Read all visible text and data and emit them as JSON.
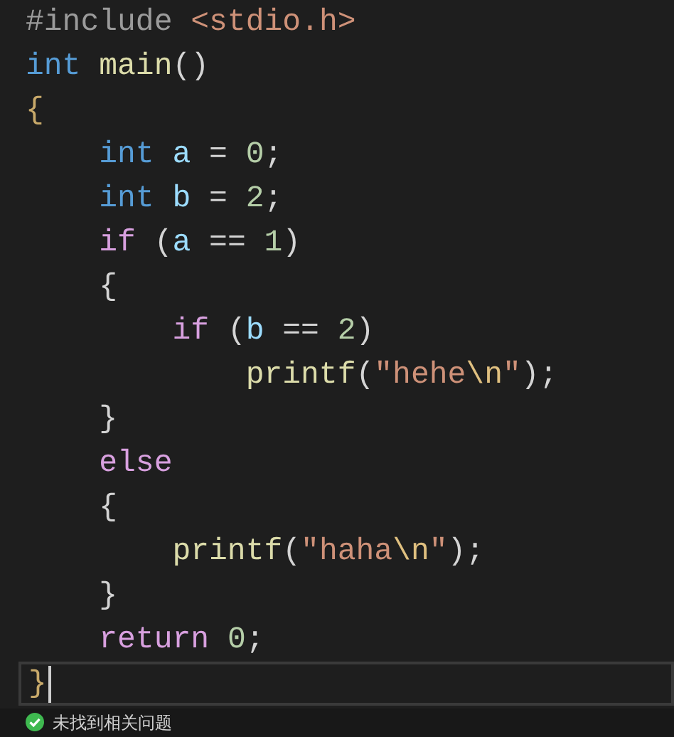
{
  "editor": {
    "lines": [
      {
        "current": false,
        "tokens": [
          {
            "kind": "preproc",
            "text": "#include "
          },
          {
            "kind": "string",
            "text": "<stdio.h>"
          }
        ]
      },
      {
        "current": false,
        "tokens": [
          {
            "kind": "keyword",
            "text": "int "
          },
          {
            "kind": "function",
            "text": "main"
          },
          {
            "kind": "plain",
            "text": "()"
          }
        ]
      },
      {
        "current": false,
        "tokens": [
          {
            "kind": "brace",
            "text": "{"
          }
        ]
      },
      {
        "current": false,
        "tokens": [
          {
            "kind": "keyword",
            "text": "    int "
          },
          {
            "kind": "variable",
            "text": "a"
          },
          {
            "kind": "plain",
            "text": " = "
          },
          {
            "kind": "number",
            "text": "0"
          },
          {
            "kind": "plain",
            "text": ";"
          }
        ]
      },
      {
        "current": false,
        "tokens": [
          {
            "kind": "keyword",
            "text": "    int "
          },
          {
            "kind": "variable",
            "text": "b"
          },
          {
            "kind": "plain",
            "text": " = "
          },
          {
            "kind": "number",
            "text": "2"
          },
          {
            "kind": "plain",
            "text": ";"
          }
        ]
      },
      {
        "current": false,
        "tokens": [
          {
            "kind": "control",
            "text": "    if "
          },
          {
            "kind": "plain",
            "text": "("
          },
          {
            "kind": "variable",
            "text": "a"
          },
          {
            "kind": "plain",
            "text": " == "
          },
          {
            "kind": "number",
            "text": "1"
          },
          {
            "kind": "plain",
            "text": ")"
          }
        ]
      },
      {
        "current": false,
        "tokens": [
          {
            "kind": "plain",
            "text": "    {"
          }
        ]
      },
      {
        "current": false,
        "tokens": [
          {
            "kind": "control",
            "text": "        if "
          },
          {
            "kind": "plain",
            "text": "("
          },
          {
            "kind": "variable",
            "text": "b"
          },
          {
            "kind": "plain",
            "text": " == "
          },
          {
            "kind": "number",
            "text": "2"
          },
          {
            "kind": "plain",
            "text": ")"
          }
        ]
      },
      {
        "current": false,
        "tokens": [
          {
            "kind": "function",
            "text": "            printf"
          },
          {
            "kind": "plain",
            "text": "("
          },
          {
            "kind": "string",
            "text": "\"hehe"
          },
          {
            "kind": "escape",
            "text": "\\n"
          },
          {
            "kind": "string",
            "text": "\""
          },
          {
            "kind": "plain",
            "text": ");"
          }
        ]
      },
      {
        "current": false,
        "tokens": [
          {
            "kind": "plain",
            "text": "    }"
          }
        ]
      },
      {
        "current": false,
        "tokens": [
          {
            "kind": "control",
            "text": "    else"
          }
        ]
      },
      {
        "current": false,
        "tokens": [
          {
            "kind": "plain",
            "text": "    {"
          }
        ]
      },
      {
        "current": false,
        "tokens": [
          {
            "kind": "function",
            "text": "        printf"
          },
          {
            "kind": "plain",
            "text": "("
          },
          {
            "kind": "string",
            "text": "\"haha"
          },
          {
            "kind": "escape",
            "text": "\\n"
          },
          {
            "kind": "string",
            "text": "\""
          },
          {
            "kind": "plain",
            "text": ");"
          }
        ]
      },
      {
        "current": false,
        "tokens": [
          {
            "kind": "plain",
            "text": "    }"
          }
        ]
      },
      {
        "current": false,
        "tokens": [
          {
            "kind": "control",
            "text": "    return "
          },
          {
            "kind": "number",
            "text": "0"
          },
          {
            "kind": "plain",
            "text": ";"
          }
        ]
      },
      {
        "current": true,
        "tokens": [
          {
            "kind": "brace",
            "text": "}"
          }
        ]
      }
    ]
  },
  "status_bar": {
    "text": "未找到相关问题"
  }
}
